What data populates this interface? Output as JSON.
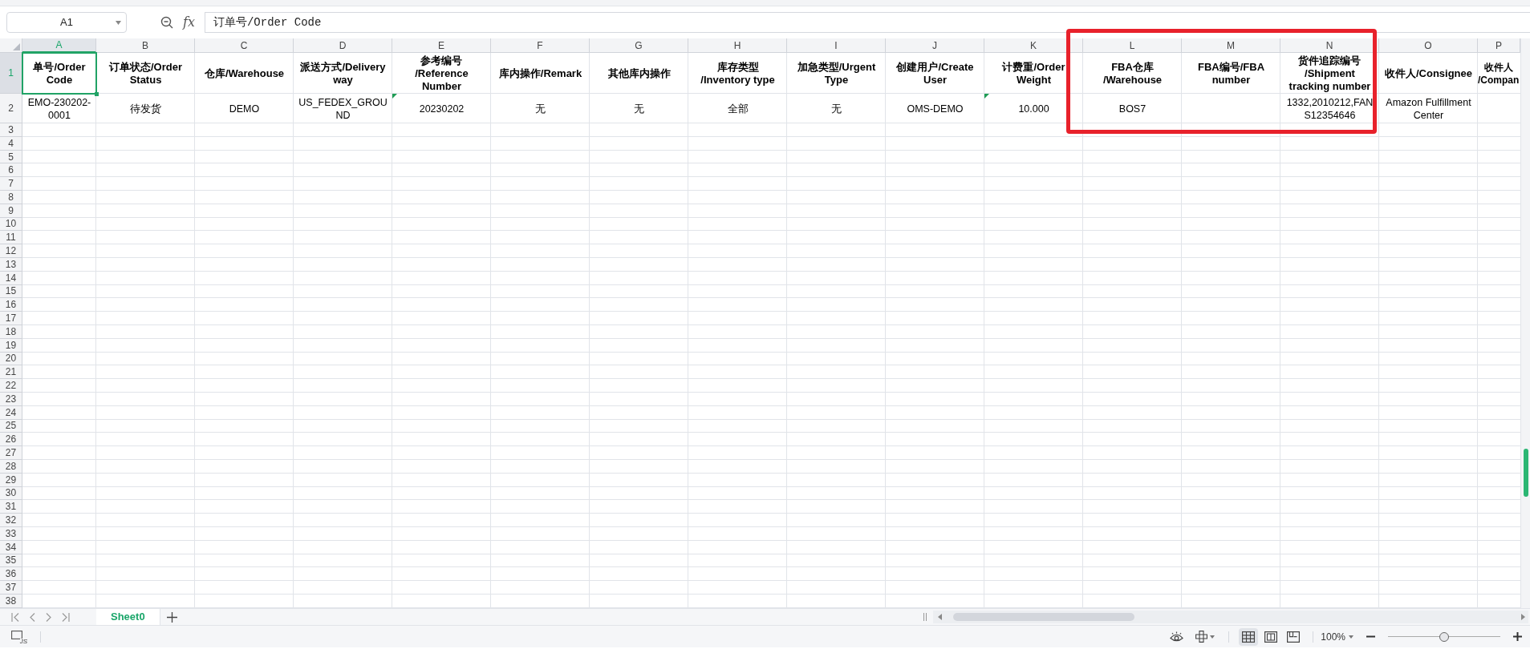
{
  "name_box": "A1",
  "fx_label": "fx",
  "formula": "订单号/Order Code",
  "columns": [
    {
      "letter": "A",
      "selected": true,
      "highlighted": false,
      "header": "单号/Order\nCode",
      "value": "EMO-230202-\n0001",
      "flag": false
    },
    {
      "letter": "B",
      "selected": false,
      "highlighted": false,
      "header": "订单状态/Order\nStatus",
      "value": "待发货",
      "flag": false
    },
    {
      "letter": "C",
      "selected": false,
      "highlighted": false,
      "header": "仓库/Warehouse",
      "value": "DEMO",
      "flag": false
    },
    {
      "letter": "D",
      "selected": false,
      "highlighted": false,
      "header": "派送方式/Delivery\nway",
      "value": "US_FEDEX_GROU\nND",
      "flag": false
    },
    {
      "letter": "E",
      "selected": false,
      "highlighted": false,
      "header": "参考编号\n/Reference\nNumber",
      "value": "20230202",
      "flag": true
    },
    {
      "letter": "F",
      "selected": false,
      "highlighted": false,
      "header": "库内操作/Remark",
      "value": "无",
      "flag": false
    },
    {
      "letter": "G",
      "selected": false,
      "highlighted": false,
      "header": "其他库内操作",
      "value": "无",
      "flag": false
    },
    {
      "letter": "H",
      "selected": false,
      "highlighted": false,
      "header": "库存类型\n/Inventory type",
      "value": "全部",
      "flag": false
    },
    {
      "letter": "I",
      "selected": false,
      "highlighted": false,
      "header": "加急类型/Urgent\nType",
      "value": "无",
      "flag": false
    },
    {
      "letter": "J",
      "selected": false,
      "highlighted": false,
      "header": "创建用户/Create\nUser",
      "value": "OMS-DEMO",
      "flag": false
    },
    {
      "letter": "K",
      "selected": false,
      "highlighted": false,
      "header": "计费重/Order\nWeight",
      "value": "10.000",
      "flag": true
    },
    {
      "letter": "L",
      "selected": false,
      "highlighted": true,
      "header": "FBA仓库\n/Warehouse",
      "value": "BOS7",
      "flag": false
    },
    {
      "letter": "M",
      "selected": false,
      "highlighted": true,
      "header": "FBA编号/FBA\nnumber",
      "flag": false
    },
    {
      "letter": "N",
      "selected": false,
      "highlighted": true,
      "header": "货件追踪编号\n/Shipment\ntracking number",
      "value": "1332,2010212,FAN\nS12354646",
      "flag": false
    },
    {
      "letter": "O",
      "selected": false,
      "highlighted": false,
      "header": "收件人/Consignee",
      "value": "Amazon Fulfillment\nCenter",
      "flag": false
    },
    {
      "letter": "P",
      "selected": false,
      "highlighted": false,
      "header": "收件人\n/Compan",
      "flag": false
    }
  ],
  "row_numbers": [
    {
      "label": "1",
      "selected": true
    },
    {
      "label": "2",
      "selected": false
    },
    {
      "label": "3",
      "selected": false
    },
    {
      "label": "4",
      "selected": false
    },
    {
      "label": "5",
      "selected": false
    },
    {
      "label": "6",
      "selected": false
    },
    {
      "label": "7",
      "selected": false
    },
    {
      "label": "8",
      "selected": false
    },
    {
      "label": "9",
      "selected": false
    },
    {
      "label": "10",
      "selected": false
    },
    {
      "label": "11",
      "selected": false
    },
    {
      "label": "12",
      "selected": false
    },
    {
      "label": "13",
      "selected": false
    },
    {
      "label": "14",
      "selected": false
    },
    {
      "label": "15",
      "selected": false
    },
    {
      "label": "16",
      "selected": false
    },
    {
      "label": "17",
      "selected": false
    },
    {
      "label": "18",
      "selected": false
    },
    {
      "label": "19",
      "selected": false
    },
    {
      "label": "20",
      "selected": false
    },
    {
      "label": "21",
      "selected": false
    },
    {
      "label": "22",
      "selected": false
    },
    {
      "label": "23",
      "selected": false
    },
    {
      "label": "24",
      "selected": false
    },
    {
      "label": "25",
      "selected": false
    },
    {
      "label": "26",
      "selected": false
    },
    {
      "label": "27",
      "selected": false
    },
    {
      "label": "28",
      "selected": false
    },
    {
      "label": "29",
      "selected": false
    },
    {
      "label": "30",
      "selected": false
    },
    {
      "label": "31",
      "selected": false
    },
    {
      "label": "32",
      "selected": false
    },
    {
      "label": "33",
      "selected": false
    },
    {
      "label": "34",
      "selected": false
    },
    {
      "label": "35",
      "selected": false
    },
    {
      "label": "36",
      "selected": false
    },
    {
      "label": "37",
      "selected": false
    },
    {
      "label": "38",
      "selected": false
    }
  ],
  "sheet_tabs": [
    {
      "label": "Sheet0",
      "selected": true
    }
  ],
  "macro_label": "JS",
  "views": [
    {
      "kind": "normal",
      "selected": true
    },
    {
      "kind": "reading",
      "selected": false
    },
    {
      "kind": "page",
      "selected": false
    }
  ],
  "zoom": {
    "reading": "100%",
    "level": 0.5
  }
}
